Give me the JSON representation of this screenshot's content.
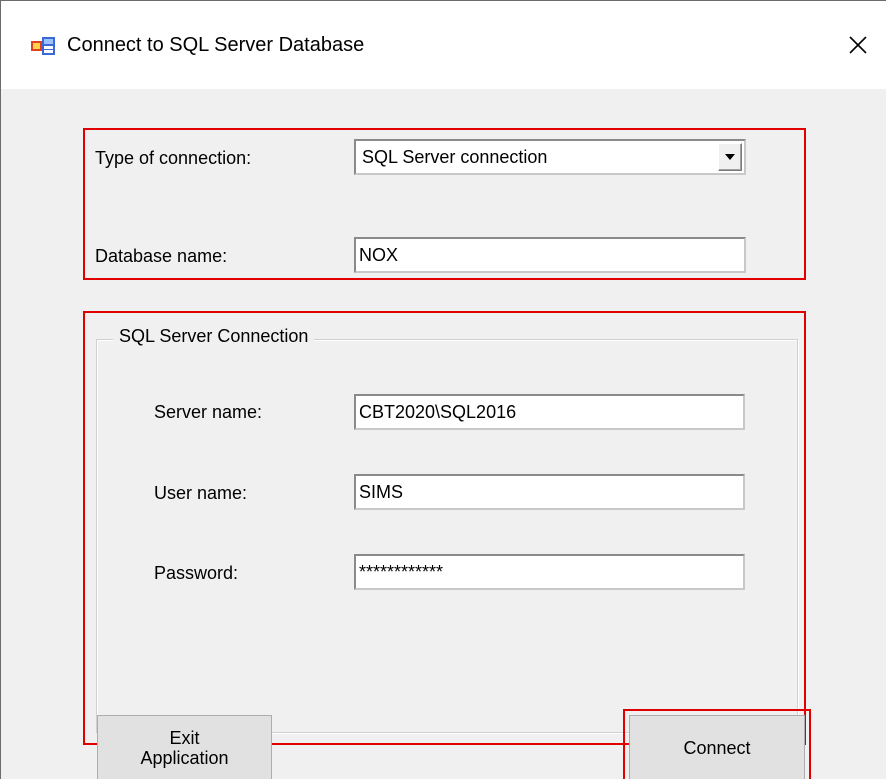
{
  "window": {
    "title": "Connect to SQL Server Database",
    "icon": "application-form-icon",
    "close_glyph": "✕"
  },
  "connection": {
    "type_label": "Type of connection:",
    "type_value": "SQL Server connection",
    "database_label": "Database name:",
    "database_value": "NOX"
  },
  "sql_group": {
    "legend": "SQL Server Connection",
    "server_label": "Server name:",
    "server_value": "CBT2020\\SQL2016",
    "user_label": "User name:",
    "user_value": "SIMS",
    "password_label": "Password:",
    "password_value": "************"
  },
  "buttons": {
    "exit_line1": "Exit",
    "exit_line2": "Application",
    "connect": "Connect"
  },
  "colors": {
    "highlight": "#e00000",
    "window_bg": "#f0f0f0",
    "button_bg": "#e1e1e1"
  }
}
